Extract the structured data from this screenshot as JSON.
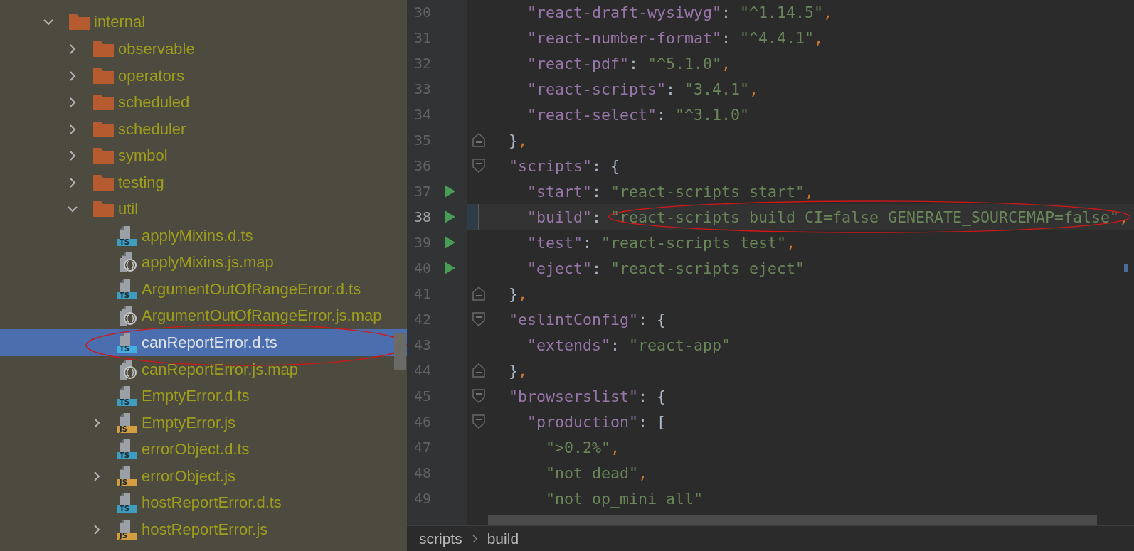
{
  "project_tree": {
    "items": [
      {
        "name": "internal",
        "kind": "folder",
        "expanded": true,
        "selected": false,
        "circled": false,
        "children": [
          {
            "name": "observable",
            "kind": "folder",
            "expanded": false,
            "selected": false,
            "circled": false
          },
          {
            "name": "operators",
            "kind": "folder",
            "expanded": false,
            "selected": false,
            "circled": false
          },
          {
            "name": "scheduled",
            "kind": "folder",
            "expanded": false,
            "selected": false,
            "circled": false
          },
          {
            "name": "scheduler",
            "kind": "folder",
            "expanded": false,
            "selected": false,
            "circled": false
          },
          {
            "name": "symbol",
            "kind": "folder",
            "expanded": false,
            "selected": false,
            "circled": false
          },
          {
            "name": "testing",
            "kind": "folder",
            "expanded": false,
            "selected": false,
            "circled": false
          },
          {
            "name": "util",
            "kind": "folder",
            "expanded": true,
            "selected": false,
            "circled": false,
            "children": [
              {
                "name": "applyMixins.d.ts",
                "kind": "ts",
                "badge": "TS",
                "selected": false,
                "circled": false
              },
              {
                "name": "applyMixins.js.map",
                "kind": "map",
                "selected": false,
                "circled": false
              },
              {
                "name": "ArgumentOutOfRangeError.d.ts",
                "kind": "ts",
                "badge": "TS",
                "selected": false,
                "circled": false
              },
              {
                "name": "ArgumentOutOfRangeError.js.map",
                "kind": "map",
                "selected": false,
                "circled": false
              },
              {
                "name": "canReportError.d.ts",
                "kind": "ts",
                "badge": "TS",
                "selected": true,
                "circled": true
              },
              {
                "name": "canReportError.js.map",
                "kind": "map",
                "selected": false,
                "circled": false
              },
              {
                "name": "EmptyError.d.ts",
                "kind": "ts",
                "badge": "TS",
                "selected": false,
                "circled": false
              },
              {
                "name": "EmptyError.js",
                "kind": "js",
                "badge": "JS",
                "expanded": false,
                "selected": false,
                "circled": false
              },
              {
                "name": "errorObject.d.ts",
                "kind": "ts",
                "badge": "TS",
                "selected": false,
                "circled": false
              },
              {
                "name": "errorObject.js",
                "kind": "js",
                "badge": "JS",
                "expanded": false,
                "selected": false,
                "circled": false
              },
              {
                "name": "hostReportError.d.ts",
                "kind": "ts",
                "badge": "TS",
                "selected": false,
                "circled": false
              },
              {
                "name": "hostReportError.js",
                "kind": "js",
                "badge": "JS",
                "expanded": false,
                "selected": false,
                "circled": false
              }
            ]
          }
        ]
      }
    ]
  },
  "editor": {
    "lines": [
      {
        "number": "30",
        "text": "    \"react-draft-wysiwyg\": \"^1.14.5\",",
        "fold_start": false,
        "fold_end": false,
        "run": false,
        "current": false,
        "circled": false
      },
      {
        "number": "31",
        "text": "    \"react-number-format\": \"^4.4.1\",",
        "fold_start": false,
        "fold_end": false,
        "run": false,
        "current": false,
        "circled": false
      },
      {
        "number": "32",
        "text": "    \"react-pdf\": \"^5.1.0\",",
        "fold_start": false,
        "fold_end": false,
        "run": false,
        "current": false,
        "circled": false
      },
      {
        "number": "33",
        "text": "    \"react-scripts\": \"3.4.1\",",
        "fold_start": false,
        "fold_end": false,
        "run": false,
        "current": false,
        "circled": false
      },
      {
        "number": "34",
        "text": "    \"react-select\": \"^3.1.0\"",
        "fold_start": false,
        "fold_end": false,
        "run": false,
        "current": false,
        "circled": false
      },
      {
        "number": "35",
        "text": "  },",
        "fold_start": false,
        "fold_end": true,
        "run": false,
        "current": false,
        "circled": false
      },
      {
        "number": "36",
        "text": "  \"scripts\": {",
        "fold_start": true,
        "fold_end": false,
        "run": false,
        "current": false,
        "circled": false
      },
      {
        "number": "37",
        "text": "    \"start\": \"react-scripts start\",",
        "fold_start": false,
        "fold_end": false,
        "run": true,
        "current": false,
        "circled": false
      },
      {
        "number": "38",
        "text": "    \"build\": \"react-scripts build CI=false GENERATE_SOURCEMAP=false\",",
        "fold_start": false,
        "fold_end": false,
        "run": true,
        "current": true,
        "circled": true
      },
      {
        "number": "39",
        "text": "    \"test\": \"react-scripts test\",",
        "fold_start": false,
        "fold_end": false,
        "run": true,
        "current": false,
        "circled": false
      },
      {
        "number": "40",
        "text": "    \"eject\": \"react-scripts eject\"",
        "fold_start": false,
        "fold_end": false,
        "run": true,
        "current": false,
        "circled": false
      },
      {
        "number": "41",
        "text": "  },",
        "fold_start": false,
        "fold_end": true,
        "run": false,
        "current": false,
        "circled": false
      },
      {
        "number": "42",
        "text": "  \"eslintConfig\": {",
        "fold_start": true,
        "fold_end": false,
        "run": false,
        "current": false,
        "circled": false
      },
      {
        "number": "43",
        "text": "    \"extends\": \"react-app\"",
        "fold_start": false,
        "fold_end": false,
        "run": false,
        "current": false,
        "circled": false
      },
      {
        "number": "44",
        "text": "  },",
        "fold_start": false,
        "fold_end": true,
        "run": false,
        "current": false,
        "circled": false
      },
      {
        "number": "45",
        "text": "  \"browserslist\": {",
        "fold_start": true,
        "fold_end": false,
        "run": false,
        "current": false,
        "circled": false
      },
      {
        "number": "46",
        "text": "    \"production\": [",
        "fold_start": true,
        "fold_end": false,
        "run": false,
        "current": false,
        "circled": false
      },
      {
        "number": "47",
        "text": "      \">0.2%\",",
        "fold_start": false,
        "fold_end": false,
        "run": false,
        "current": false,
        "circled": false
      },
      {
        "number": "48",
        "text": "      \"not dead\",",
        "fold_start": false,
        "fold_end": false,
        "run": false,
        "current": false,
        "circled": false
      },
      {
        "number": "49",
        "text": "      \"not op_mini all\"",
        "fold_start": false,
        "fold_end": false,
        "run": false,
        "current": false,
        "circled": false
      }
    ]
  },
  "breadcrumbs": [
    {
      "label": "scripts"
    },
    {
      "label": "build"
    }
  ]
}
